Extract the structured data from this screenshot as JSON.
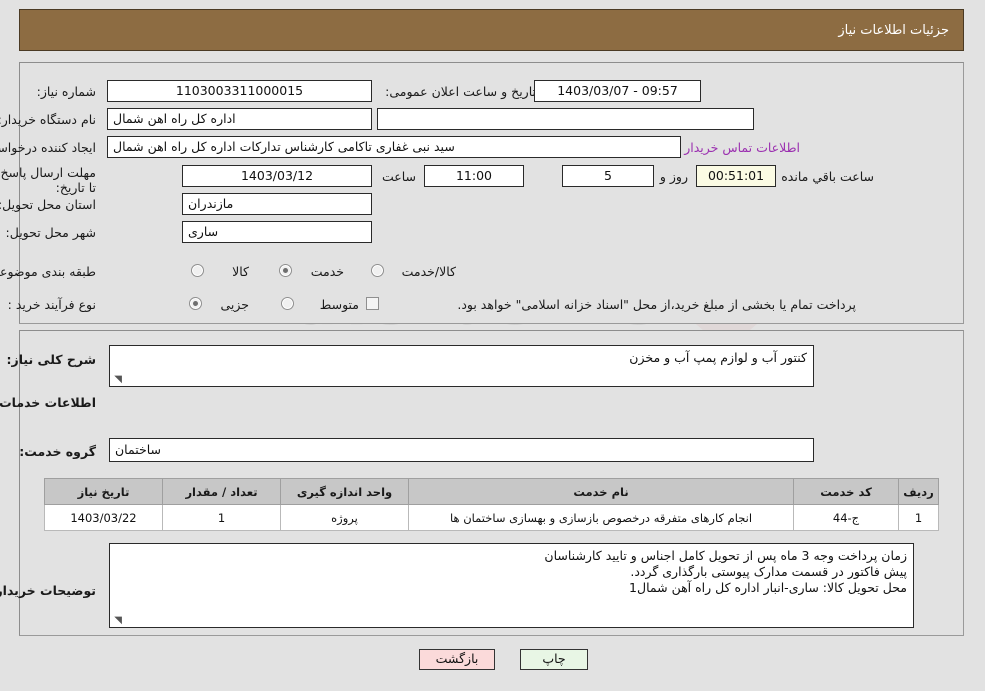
{
  "header": {
    "title": "جزئیات اطلاعات نیاز"
  },
  "top_section": {
    "need_number_label": "شماره نیاز:",
    "need_number_value": "1103003311000015",
    "announce_datetime_label": "تاریخ و ساعت اعلان عمومی:",
    "announce_datetime_value": "09:57 - 1403/03/07",
    "buyer_org_label": "نام دستگاه خریدار:",
    "buyer_org_value": "اداره کل راه اهن شمال",
    "second_row_extra_value": "",
    "requester_label": "ایجاد کننده درخواست:",
    "requester_value": "سید نبی غفاری تاکامی کارشناس تدارکات اداره کل راه اهن شمال",
    "buyer_contact_link": "اطلاعات تماس خریدار",
    "deadline_label": "مهلت ارسال پاسخ: تا تاریخ:",
    "deadline_date": "1403/03/12",
    "hour_word": "ساعت",
    "deadline_time": "11:00",
    "days_remaining": "5",
    "days_word": "روز و",
    "hours_remaining": "00:51:01",
    "remaining_suffix": "ساعت باقي مانده",
    "province_label": "استان محل تحویل:",
    "province_value": "مازندران",
    "city_label": "شهر محل تحویل:",
    "city_value": "ساری",
    "category_label": "طبقه بندی موضوعی:",
    "category_options": [
      "کالا",
      "خدمت",
      "کالا/خدمت"
    ],
    "category_selected": "خدمت",
    "process_label": "نوع فرآیند خرید :",
    "process_options": [
      "جزیی",
      "متوسط"
    ],
    "process_selected": "جزیی",
    "treasury_checkbox_label": "پرداخت تمام یا بخشی از مبلغ خرید،از محل \"اسناد خزانه اسلامی\" خواهد بود.",
    "treasury_checked": false
  },
  "bottom_section": {
    "general_desc_label": "شرح کلی نیاز:",
    "general_desc_value": "کنتور آب و لوازم پمپ آب و مخزن",
    "services_info_title": "اطلاعات خدمات مورد نیاز",
    "service_group_label": "گروه خدمت:",
    "service_group_value": "ساختمان",
    "buyer_notes_label": "توضیحات خریدار:",
    "buyer_notes_lines": [
      "زمان پرداخت وجه 3 ماه پس از تحویل کامل اجناس و تایید کارشناسان",
      "پیش فاکتور در قسمت مدارک پیوستی بارگذاری گردد.",
      "محل تحویل کالا: ساری-انبار اداره کل راه آهن شمال1"
    ]
  },
  "table": {
    "headers": [
      "ردیف",
      "کد خدمت",
      "نام خدمت",
      "واحد اندازه گیری",
      "تعداد / مقدار",
      "تاریخ نیاز"
    ],
    "rows": [
      {
        "row": "1",
        "code": "ج-44",
        "name": "انجام کارهای متفرقه درخصوص بازسازی و بهسازی ساختمان ها",
        "unit": "پروژه",
        "qty": "1",
        "date": "1403/03/22"
      }
    ]
  },
  "footer": {
    "print_label": "چاپ",
    "back_label": "بازگشت"
  },
  "watermark": {
    "text": "AnaTender.net"
  },
  "colors": {
    "header_bg": "#8d6c42",
    "page_bg": "#e2e2e2",
    "link": "#9b30b0",
    "table_header_bg": "#c7c7c7",
    "print_btn_bg": "#e8f6e5",
    "back_btn_bg": "#fbdada",
    "highlight_field_bg": "#fbfbe4"
  }
}
